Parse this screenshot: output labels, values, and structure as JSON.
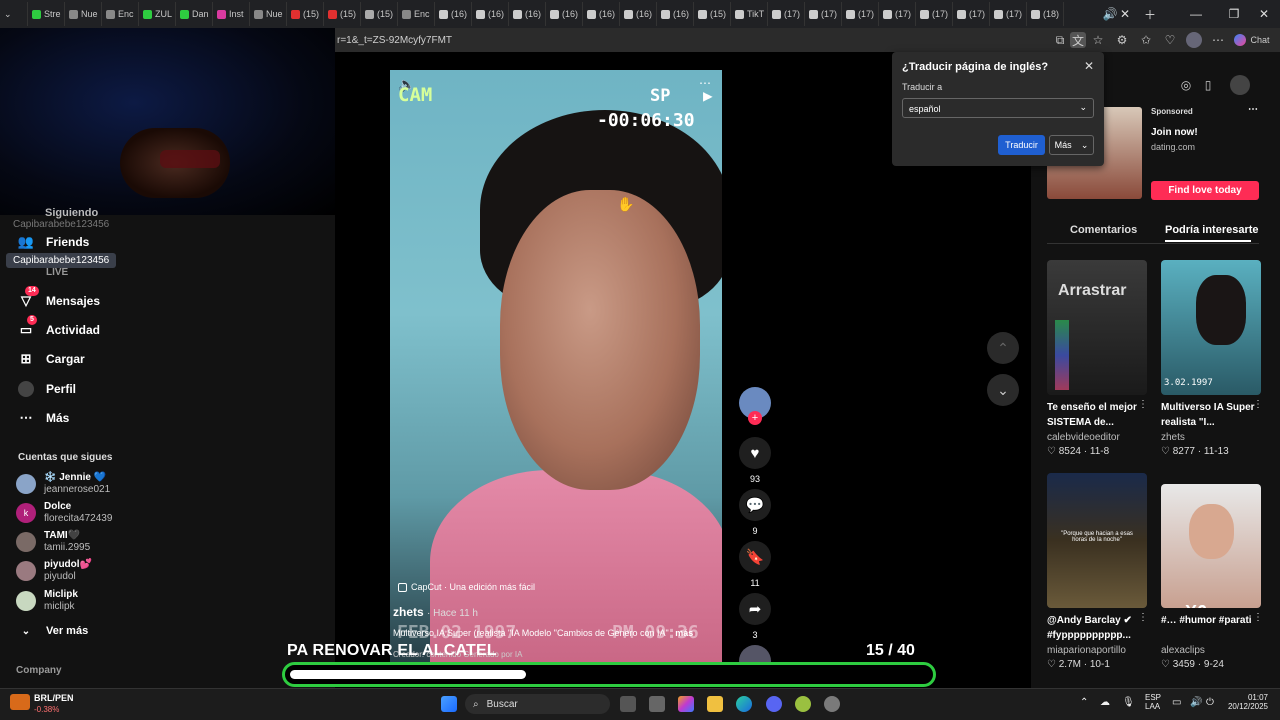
{
  "browser": {
    "tabs": [
      "Stre",
      "Nue",
      "Enc",
      "ZUL",
      "Dan",
      "Inst",
      "Nue",
      "(15)",
      "(15)",
      "(15)",
      "Enc",
      "(16)",
      "(16)",
      "(16)",
      "(16)",
      "(16)",
      "(16)",
      "(16)",
      "(15)",
      "TikT",
      "(17)",
      "(17)",
      "(17)",
      "(17)",
      "(17)",
      "(17)",
      "(17)",
      "(18)"
    ],
    "url": "r=1&_t=ZS-92Mcyfy7FMT",
    "copilot_label": "Chat"
  },
  "translate_popup": {
    "title": "¿Traducir página de inglés?",
    "label": "Traducir a",
    "selected_language": "español",
    "translate_button": "Traducir",
    "more_button": "Más"
  },
  "sidebar": {
    "partial_top": "Siguiendo",
    "partial_handle": "Capibarabebe123456",
    "tooltip": "Capibarabebe123456",
    "items": [
      {
        "label": "Friends",
        "icon": "friends-icon"
      },
      {
        "label": "LIVE",
        "icon": "live-icon"
      },
      {
        "label": "Mensajes",
        "icon": "messages-icon",
        "badge": "14"
      },
      {
        "label": "Actividad",
        "icon": "activity-icon",
        "badge": "5"
      },
      {
        "label": "Cargar",
        "icon": "upload-icon"
      },
      {
        "label": "Perfil",
        "icon": "profile-icon"
      },
      {
        "label": "Más",
        "icon": "more-icon"
      }
    ],
    "following_heading": "Cuentas que sigues",
    "following": [
      {
        "name": "❄️ Jennie 💙",
        "handle": "jeannerose021",
        "color": "#8aa4c8"
      },
      {
        "name": "Dolce",
        "handle": "florecita472439",
        "color": "#b0207a"
      },
      {
        "name": "TAMI🖤",
        "handle": "tamii.2995",
        "color": "#7a6a66"
      },
      {
        "name": "piyudol💕",
        "handle": "piyudol",
        "color": "#9a7a80"
      },
      {
        "name": "Miclipk",
        "handle": "miclipk",
        "color": "#c8d8c0"
      }
    ],
    "see_more": "Ver más",
    "company": "Company"
  },
  "video": {
    "cam_label": "CAM",
    "sp_label": "SP",
    "timecode": "-00:06:30",
    "capcut_label": "CapCut · Una edición más fácil",
    "author": "zhets",
    "posted": "· Hace 11 h",
    "date_overlay": "FEB.02 1997",
    "time_overlay": "PM 09:36",
    "caption": "Multiverso IA Super (realista \"IA Modelo \"Cambios de Género con IA\"",
    "caption_more": "más",
    "caption_sub": "Creador: contenido Generado por IA"
  },
  "actions": {
    "likes": "93",
    "comments": "9",
    "saves": "11",
    "shares": "3"
  },
  "ad": {
    "sponsored": "Sponsored",
    "title": "Join now!",
    "domain": "dating.com",
    "cta": "Find love today"
  },
  "right_tabs": [
    "Comentarios",
    "Podría interesarte"
  ],
  "cards": [
    {
      "title": "Te enseño el mejor SISTEMA de...",
      "author": "calebvideoeditor",
      "likes": "8524",
      "date": "11-8",
      "thumb_text": "Arrastrar"
    },
    {
      "title": "Multiverso IA Super realista \"I...",
      "author": "zhets",
      "likes": "8277",
      "date": "11-13",
      "thumb_text": "3.02.1997"
    },
    {
      "title": "@Andy Barclay ✔ #fypppppppppp...",
      "author": "miaparionaportillo",
      "likes": "2.7M",
      "date": "10-1",
      "thumb_text": "\"Porque que hacian a esas horas de la noche\""
    },
    {
      "title": "#… #humor #parati",
      "author": "alexaclips",
      "likes": "3459",
      "date": "9-24",
      "thumb_text": "X6"
    }
  ],
  "overlay": {
    "title": "PA RENOVAR EL ALCATEL",
    "count": "15 / 40",
    "progress_fraction": 0.37
  },
  "taskbar": {
    "stock_name": "BRL/PEN",
    "stock_change": "-0.38%",
    "search_placeholder": "Buscar",
    "lang_line1": "ESP",
    "lang_line2": "LAA",
    "time": "01:07",
    "date": "20/12/2025"
  },
  "colors": {
    "accent": "#fe2c55",
    "progress_border": "#2ecc40",
    "translate_button": "#1f5fd1"
  }
}
